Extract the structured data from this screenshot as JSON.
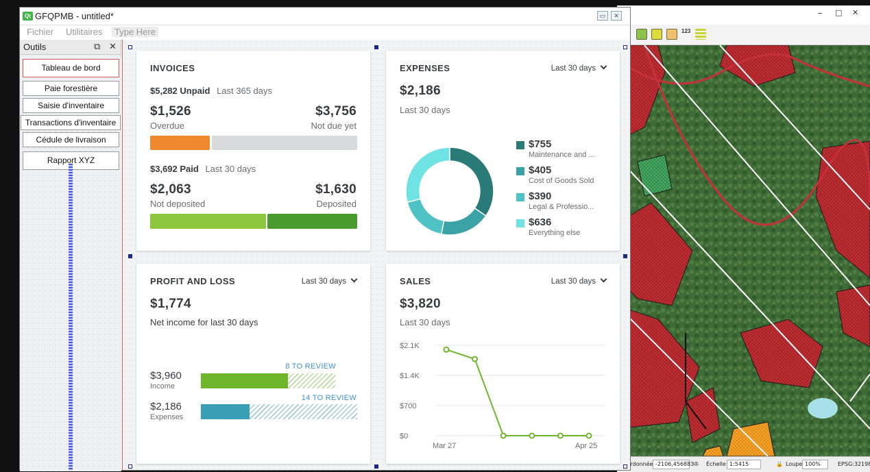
{
  "app": {
    "title": "GFQPMB - untitled*",
    "logo": "Qt",
    "menus": [
      "Fichier",
      "Utilitaires",
      "Type Here"
    ]
  },
  "outils": {
    "title": "Outils",
    "undock_icon": "⧉",
    "close_icon": "✕",
    "buttons": [
      "Tableau de bord",
      "Paie forestière",
      "Saisie d'inventaire",
      "Transactions d'inventaire",
      "Cédule de livraison",
      "Rapport XYZ"
    ]
  },
  "invoices": {
    "title": "INVOICES",
    "unpaid_amount": "$5,282 Unpaid",
    "unpaid_period": "Last 365 days",
    "overdue_value": "$1,526",
    "overdue_label": "Overdue",
    "notdue_value": "$3,756",
    "notdue_label": "Not due yet",
    "overdue_fraction": 0.289,
    "paid_amount": "$3,692 Paid",
    "paid_period": "Last 30 days",
    "notdeposited_value": "$2,063",
    "notdeposited_label": "Not deposited",
    "deposited_value": "$1,630",
    "deposited_label": "Deposited",
    "notdeposited_fraction": 0.559,
    "colors": {
      "overdue": "#f0882f",
      "notdue": "#d9dadc",
      "notdeposited": "#8dc63f",
      "deposited": "#4a9b2f"
    }
  },
  "expenses": {
    "title": "EXPENSES",
    "period": "Last 30 days",
    "total": "$2,186",
    "subtitle": "Last 30 days",
    "items": [
      {
        "value": "$755",
        "label": "Maintenance and ...",
        "color": "#2a7a78",
        "amount": 755
      },
      {
        "value": "$405",
        "label": "Cost of Goods Sold",
        "color": "#3ba3a6",
        "amount": 405
      },
      {
        "value": "$390",
        "label": "Legal & Professio...",
        "color": "#4fc2c6",
        "amount": 390
      },
      {
        "value": "$636",
        "label": "Everything else",
        "color": "#6fe3e3",
        "amount": 636
      }
    ]
  },
  "profit_loss": {
    "title": "PROFIT AND LOSS",
    "period": "Last 30 days",
    "total": "$1,774",
    "subtitle": "Net income for last 30 days",
    "income_value": "$3,960",
    "income_label": "Income",
    "income_review": "8 TO REVIEW",
    "income_fraction": 0.65,
    "expenses_value": "$2,186",
    "expenses_label": "Expenses",
    "expenses_review": "14 TO REVIEW",
    "expenses_fraction": 0.31,
    "colors": {
      "income": "#6fb52c",
      "expenses": "#3a9fb5"
    }
  },
  "sales": {
    "title": "SALES",
    "period": "Last 30 days",
    "total": "$3,820",
    "subtitle": "Last 30 days"
  },
  "chart_data": {
    "type": "line",
    "x_tick_labels": [
      "Mar 27",
      "Apr 25"
    ],
    "y_tick_labels": [
      "$2.1K",
      "$1.4K",
      "$700",
      "$0"
    ],
    "y_ticks": [
      2100,
      1400,
      700,
      0
    ],
    "ylim": [
      0,
      2100
    ],
    "values": [
      2000,
      1780,
      0,
      0,
      0,
      0
    ],
    "color": "#6fb52c",
    "grid": true
  },
  "map": {
    "window_controls": [
      "–",
      "□",
      "✕"
    ],
    "toolbar_icons": [
      "layer-icon",
      "add-layer-icon",
      "style-icon",
      "number-field-icon",
      "legend-icon"
    ],
    "toolbar_numeric_label": "123",
    "status": {
      "coordinate_label": "Coordonnée",
      "coordinate_value": "-2106,456883",
      "scale_label": "Échelle",
      "scale_value": "1:5415",
      "magnifier_label": "Loupe",
      "magnifier_value": "100%",
      "crs": "EPSG:32198"
    }
  }
}
